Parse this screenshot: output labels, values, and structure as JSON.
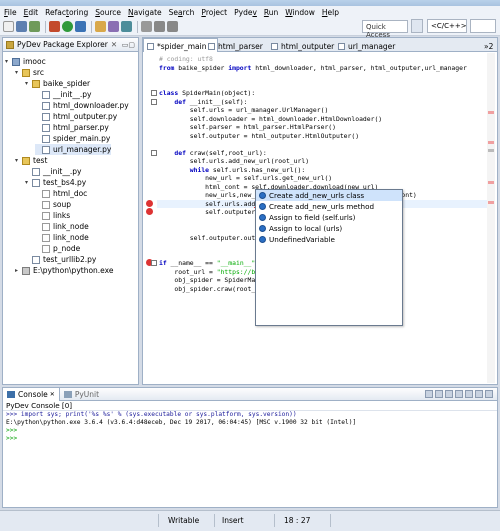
{
  "menubar": {
    "items": [
      {
        "pre": "",
        "accel": "F",
        "post": "ile"
      },
      {
        "pre": "",
        "accel": "E",
        "post": "dit"
      },
      {
        "pre": "Refac",
        "accel": "t",
        "post": "oring"
      },
      {
        "pre": "",
        "accel": "S",
        "post": "ource"
      },
      {
        "pre": "",
        "accel": "N",
        "post": "avigate"
      },
      {
        "pre": "Se",
        "accel": "a",
        "post": "rch"
      },
      {
        "pre": "",
        "accel": "P",
        "post": "roject"
      },
      {
        "pre": "Pyde",
        "accel": "v",
        "post": ""
      },
      {
        "pre": "",
        "accel": "R",
        "post": "un"
      },
      {
        "pre": "",
        "accel": "W",
        "post": "indow"
      },
      {
        "pre": "",
        "accel": "H",
        "post": "elp"
      }
    ]
  },
  "toolbar": {
    "quick_access": "Quick Access",
    "perspective_label": "<C/C++>",
    "perspective2_label": ""
  },
  "package_explorer": {
    "title": "PyDev Package Explorer",
    "items": [
      {
        "label": "imooc",
        "icon": "project-icon",
        "indent": 0,
        "twisty": "▾"
      },
      {
        "label": "src",
        "icon": "folder-icon",
        "indent": 1,
        "twisty": "▾"
      },
      {
        "label": "baike_spider",
        "icon": "package-icon",
        "indent": 2,
        "twisty": "▾"
      },
      {
        "label": "__init__.py",
        "icon": "python-file-icon",
        "indent": 3,
        "twisty": ""
      },
      {
        "label": "html_downloader.py",
        "icon": "python-file-icon",
        "indent": 3,
        "twisty": ""
      },
      {
        "label": "html_outputer.py",
        "icon": "python-file-icon",
        "indent": 3,
        "twisty": ""
      },
      {
        "label": "html_parser.py",
        "icon": "python-file-icon",
        "indent": 3,
        "twisty": ""
      },
      {
        "label": "spider_main.py",
        "icon": "python-file-icon",
        "indent": 3,
        "twisty": ""
      },
      {
        "label": "url_manager.py",
        "icon": "python-file-icon",
        "indent": 3,
        "twisty": ""
      },
      {
        "label": "test",
        "icon": "package-icon",
        "indent": 1,
        "twisty": "▾"
      },
      {
        "label": "__init__.py",
        "icon": "python-file-icon",
        "indent": 2,
        "twisty": ""
      },
      {
        "label": "test_bs4.py",
        "icon": "python-file-icon",
        "indent": 2,
        "twisty": "▾"
      },
      {
        "label": "html_doc",
        "icon": "variable-icon",
        "indent": 3,
        "twisty": ""
      },
      {
        "label": "soup",
        "icon": "variable-icon",
        "indent": 3,
        "twisty": ""
      },
      {
        "label": "links",
        "icon": "variable-icon",
        "indent": 3,
        "twisty": ""
      },
      {
        "label": "link_node",
        "icon": "variable-icon",
        "indent": 3,
        "twisty": ""
      },
      {
        "label": "link_node",
        "icon": "variable-icon",
        "indent": 3,
        "twisty": ""
      },
      {
        "label": "p_node",
        "icon": "variable-icon",
        "indent": 3,
        "twisty": ""
      },
      {
        "label": "test_urllib2.py",
        "icon": "python-file-icon",
        "indent": 2,
        "twisty": ""
      },
      {
        "label": "E:\\python\\python.exe",
        "icon": "interpreter-icon",
        "indent": 1,
        "twisty": "▸"
      }
    ]
  },
  "editor": {
    "tabs": [
      {
        "label": "*spider_main",
        "active": true
      },
      {
        "label": "html_parser",
        "active": false
      },
      {
        "label": "html_outputer",
        "active": false
      },
      {
        "label": "url_manager",
        "active": false
      }
    ],
    "tab_overflow": "»2",
    "code_lines": [
      [
        {
          "t": "# coding: utf8",
          "c": "cm"
        }
      ],
      [
        {
          "t": "from",
          "c": "kw"
        },
        {
          "t": " baike_spider ",
          "c": ""
        },
        {
          "t": "import",
          "c": "kw"
        },
        {
          "t": " html_downloader, html_parser, html_outputer,url_manager",
          "c": ""
        }
      ],
      [
        {
          "t": "",
          "c": ""
        }
      ],
      [
        {
          "t": "",
          "c": ""
        }
      ],
      [
        {
          "t": "class",
          "c": "kw"
        },
        {
          "t": " SpiderMain(object):",
          "c": ""
        }
      ],
      [
        {
          "t": "    ",
          "c": ""
        },
        {
          "t": "def",
          "c": "kw"
        },
        {
          "t": " __init__(self):",
          "c": ""
        }
      ],
      [
        {
          "t": "        self.urls = url_manager.UrlManager()",
          "c": ""
        }
      ],
      [
        {
          "t": "        self.downloader = html_downloader.HtmlDownloader()",
          "c": ""
        }
      ],
      [
        {
          "t": "        self.parser = html_parser.HtmlParser()",
          "c": ""
        }
      ],
      [
        {
          "t": "        self.outputer = html_outputer.HtmlOutputer()",
          "c": ""
        }
      ],
      [
        {
          "t": "",
          "c": ""
        }
      ],
      [
        {
          "t": "    ",
          "c": ""
        },
        {
          "t": "def",
          "c": "kw"
        },
        {
          "t": " craw(self,root_url):",
          "c": ""
        }
      ],
      [
        {
          "t": "        self.urls.add_new_url(root_url)",
          "c": ""
        }
      ],
      [
        {
          "t": "        ",
          "c": ""
        },
        {
          "t": "while",
          "c": "kw"
        },
        {
          "t": " self.urls.has_new_url():",
          "c": ""
        }
      ],
      [
        {
          "t": "            new_url = self.urls.get_new_url()",
          "c": ""
        }
      ],
      [
        {
          "t": "            html_cont = self.downloader.download(new_url)",
          "c": ""
        }
      ],
      [
        {
          "t": "            new_urls,new_data =self.parser.parse(new_url,html_cont)",
          "c": ""
        }
      ],
      [
        {
          "t": "            self.urls.add_new_urls(new_urls)",
          "c": ""
        }
      ],
      [
        {
          "t": "            self.outputer.",
          "c": ""
        }
      ],
      [
        {
          "t": "",
          "c": ""
        }
      ],
      [
        {
          "t": "",
          "c": ""
        }
      ],
      [
        {
          "t": "        self.outputer.outp",
          "c": ""
        }
      ],
      [
        {
          "t": "",
          "c": ""
        }
      ],
      [
        {
          "t": "",
          "c": ""
        }
      ],
      [
        {
          "t": "if",
          "c": "kw"
        },
        {
          "t": " __name__ == ",
          "c": ""
        },
        {
          "t": "\"__main__\"",
          "c": "st"
        },
        {
          "t": ":",
          "c": ""
        }
      ],
      [
        {
          "t": "    root_url = ",
          "c": ""
        },
        {
          "t": "\"https://ba",
          "c": "st"
        }
      ],
      [
        {
          "t": "    obj_spider = SpiderMai",
          "c": ""
        }
      ],
      [
        {
          "t": "    obj_spider.craw(root_u",
          "c": ""
        }
      ]
    ]
  },
  "autocomplete": {
    "items": [
      {
        "label": "Create add_new_urls class",
        "selected": true
      },
      {
        "label": "Create add_new_urls method",
        "selected": false
      },
      {
        "label": "Assign to field (self.urls)",
        "selected": false
      },
      {
        "label": "Assign to local (urls)",
        "selected": false
      },
      {
        "label": "UndefinedVariable",
        "selected": false
      }
    ]
  },
  "console": {
    "tabs": [
      {
        "label": "Console",
        "active": true
      },
      {
        "label": "PyUnit",
        "active": false
      }
    ],
    "subtitle": "PyDev Console [0]",
    "lines": [
      {
        "t": ">>> import sys; print('%s %s' % (sys.executable or sys.platform, sys.version))",
        "c": "con-blue"
      },
      {
        "t": "E:\\python\\python.exe 3.6.4 (v3.6.4:d48eceb, Dec 19 2017, 06:04:45) [MSC v.1900 32 bit (Intel)]",
        "c": ""
      },
      {
        "t": ">>>",
        "c": "con-green"
      },
      {
        "t": ">>>",
        "c": "con-green"
      }
    ]
  },
  "statusbar": {
    "writable": "Writable",
    "insert": "Insert",
    "position": "18 : 27"
  }
}
